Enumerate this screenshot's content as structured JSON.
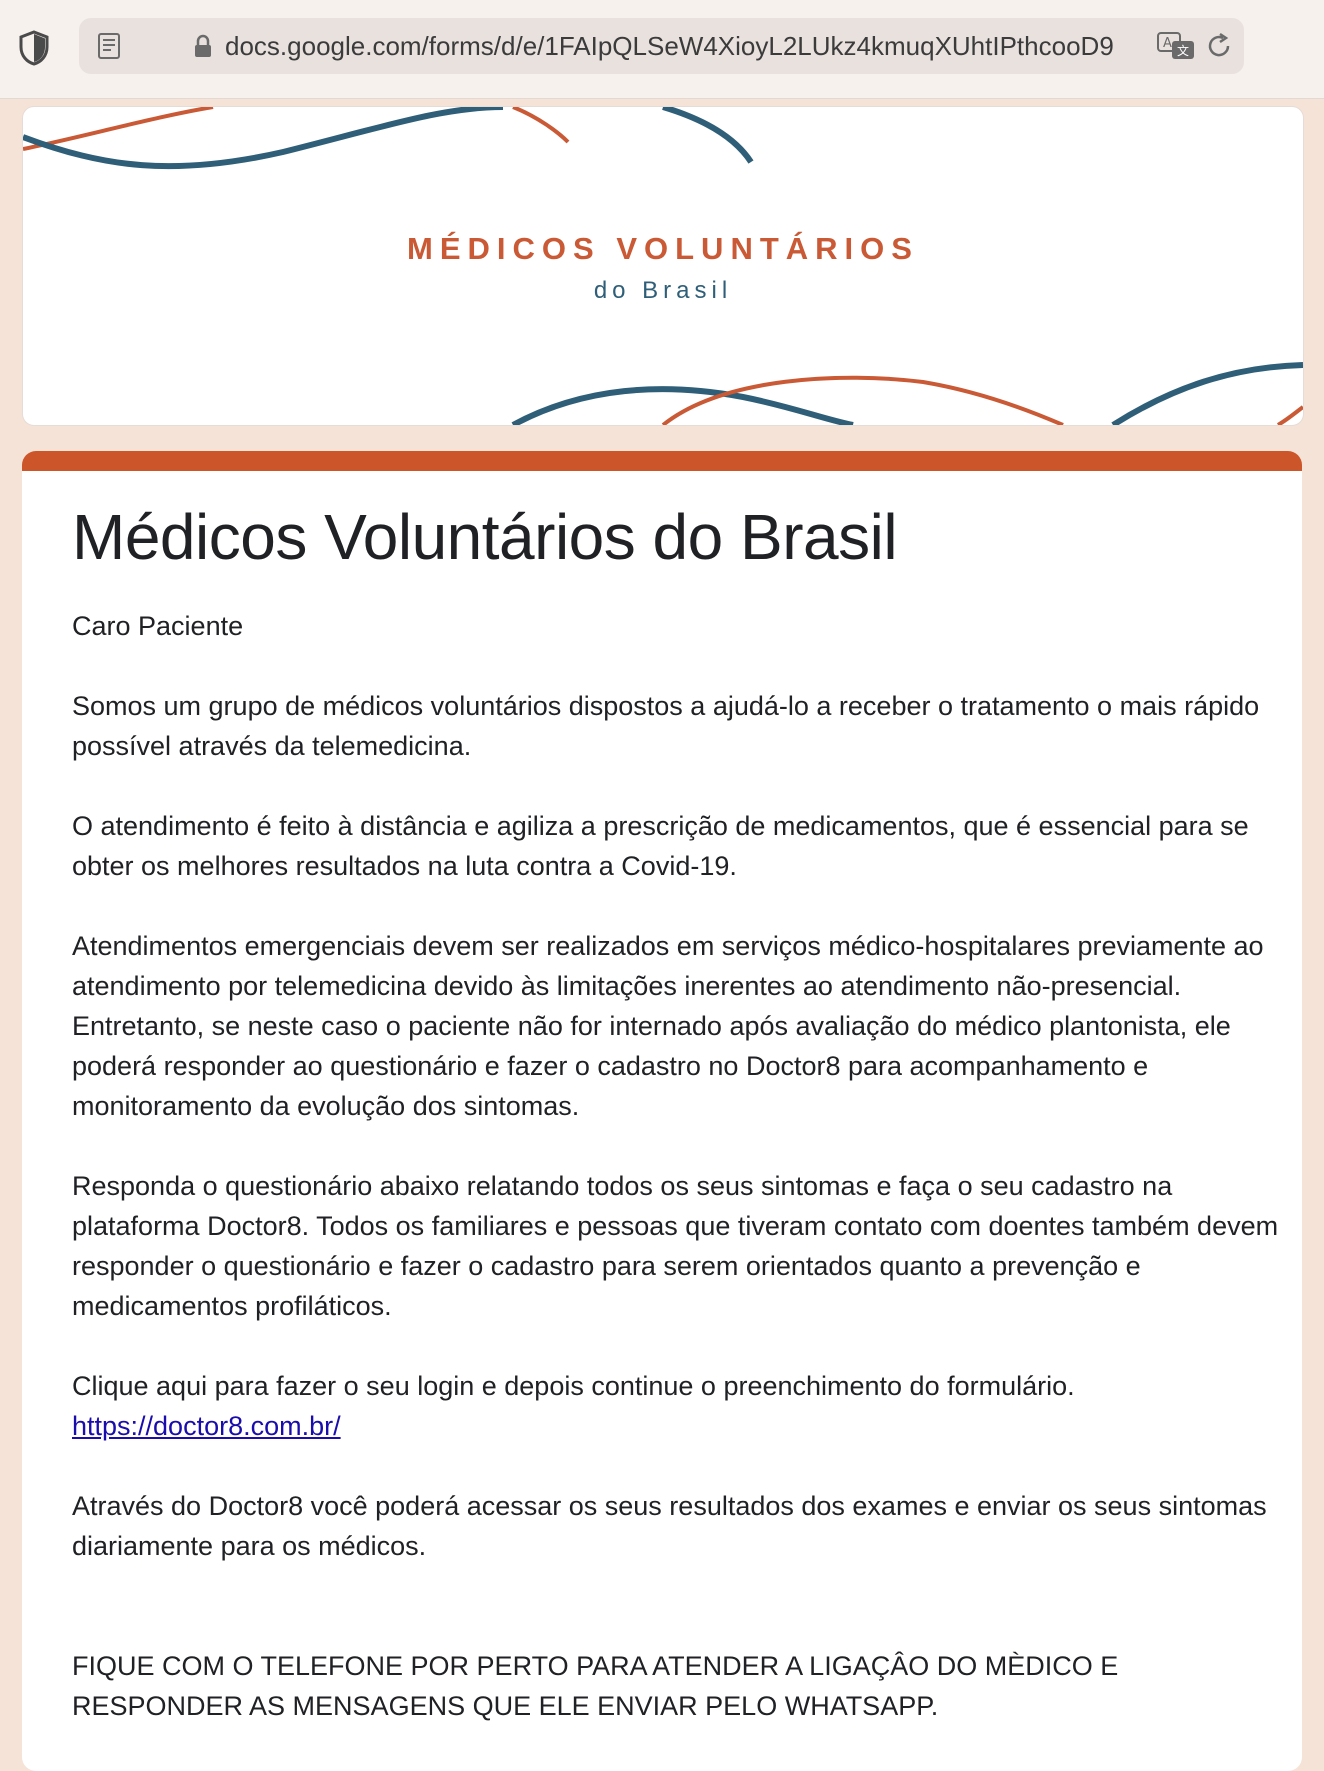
{
  "browser": {
    "url": "docs.google.com/forms/d/e/1FAIpQLSeW4XioyL2LUkz4kmuqXUhtIPthcooD9",
    "icons": [
      "shield-icon",
      "reader-icon",
      "lock-icon",
      "translate-icon",
      "reload-icon"
    ]
  },
  "banner": {
    "title": "MÉDICOS VOLUNTÁRIOS",
    "subtitle": "do Brasil",
    "colors": {
      "orange": "#c95a35",
      "blue": "#2f5f78"
    }
  },
  "form": {
    "accent_color": "#cc5629",
    "title": "Médicos Voluntários do Brasil",
    "greeting": "Caro Paciente",
    "p1": "Somos um grupo de médicos voluntários dispostos a ajudá-lo a receber o tratamento o mais rápido possível através da telemedicina.",
    "p2": "O atendimento é feito à distância e agiliza a prescrição de medicamentos, que é essencial para se obter os melhores resultados na luta contra a Covid-19.",
    "p3": "Atendimentos emergenciais devem ser realizados em serviços médico-hospitalares previamente ao atendimento por telemedicina devido às limitações inerentes ao atendimento não-presencial. Entretanto, se neste caso o paciente não for internado após avaliação do médico plantonista, ele poderá responder ao questionário e fazer o cadastro no Doctor8 para acompanhamento e monitoramento da evolução dos sintomas.",
    "p4": "Responda o questionário abaixo relatando todos os seus sintomas e faça o seu cadastro na plataforma Doctor8. Todos os familiares e pessoas que tiveram contato com doentes também devem responder o questionário e fazer o cadastro para serem orientados quanto a prevenção e medicamentos profiláticos.",
    "p5": "Clique aqui para fazer o seu login e depois continue o preenchimento do formulário.",
    "link": "https://doctor8.com.br/",
    "p6": "Através do Doctor8 você poderá acessar os seus resultados dos exames  e enviar os seus sintomas diariamente para os médicos.",
    "p7": "FIQUE COM O TELEFONE POR PERTO PARA ATENDER A LIGAÇÂO DO MÈDICO E RESPONDER AS MENSAGENS QUE ELE ENVIAR PELO WHATSAPP."
  }
}
